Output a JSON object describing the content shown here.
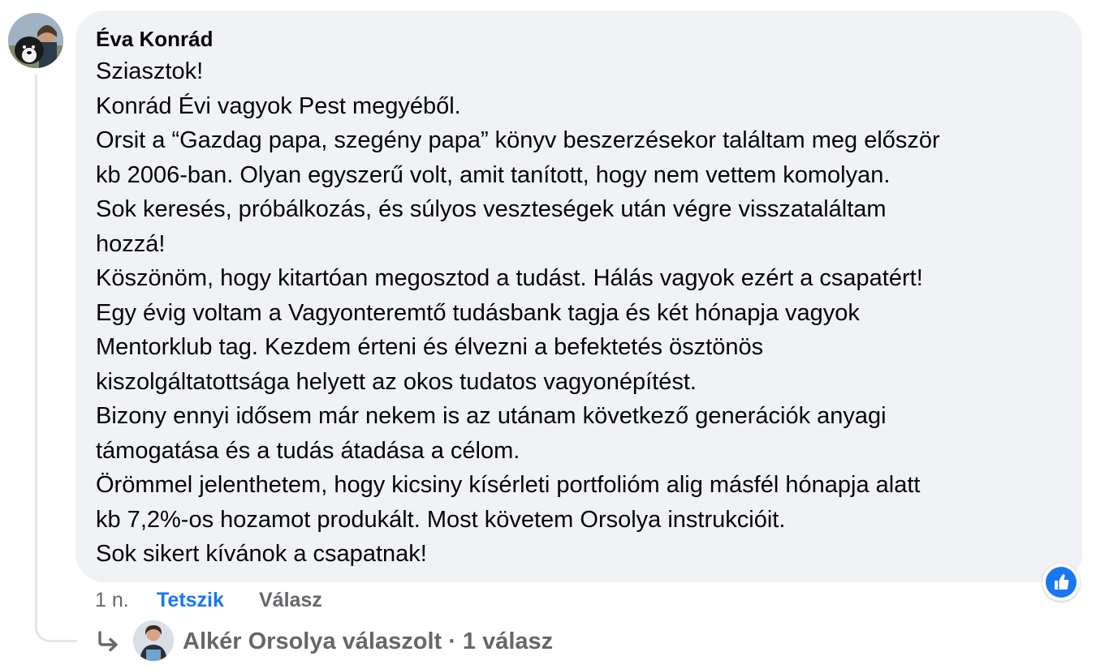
{
  "comment": {
    "author": "Éva Konrád",
    "lines": [
      "Sziasztok!",
      "Konrád Évi vagyok Pest megyéből.",
      "Orsit a “Gazdag papa, szegény papa” könyv beszerzésekor találtam meg először",
      "kb 2006-ban. Olyan egyszerű volt, amit tanított, hogy nem vettem komolyan.",
      "Sok keresés, próbálkozás, és súlyos veszteségek után végre visszataláltam",
      "hozzá!",
      "Köszönöm, hogy kitartóan megosztod a tudást. Hálás vagyok ezért a csapatért!",
      "Egy évig voltam a Vagyonteremtő tudásbank tagja és két hónapja vagyok",
      "Mentorklub tag. Kezdem érteni és élvezni a befektetés ösztönös",
      "kiszolgáltatottsága helyett az okos tudatos vagyonépítést.",
      "Bizony ennyi idősem már nekem is az utánam következő generációk anyagi",
      "támogatása és a tudás átadása a célom.",
      "Örömmel jelenthetem, hogy kicsiny kísérleti portfolióm alig másfél hónapja alatt",
      "kb 7,2%-os hozamot produkált. Most követem Orsolya instrukcióit.",
      "Sok sikert kívánok a csapatnak!"
    ],
    "time": "1 n.",
    "like_label": "Tetszik",
    "reply_label": "Válasz",
    "reaction_icon": "thumbs-up-icon"
  },
  "replies": {
    "text": "Alkér Orsolya válaszolt · 1 válasz",
    "arrow_icon": "reply-arrow-icon"
  },
  "colors": {
    "bubble": "#f0f2f5",
    "link_blue": "#1877f2",
    "secondary_text": "#65676b",
    "primary_text": "#050505"
  }
}
